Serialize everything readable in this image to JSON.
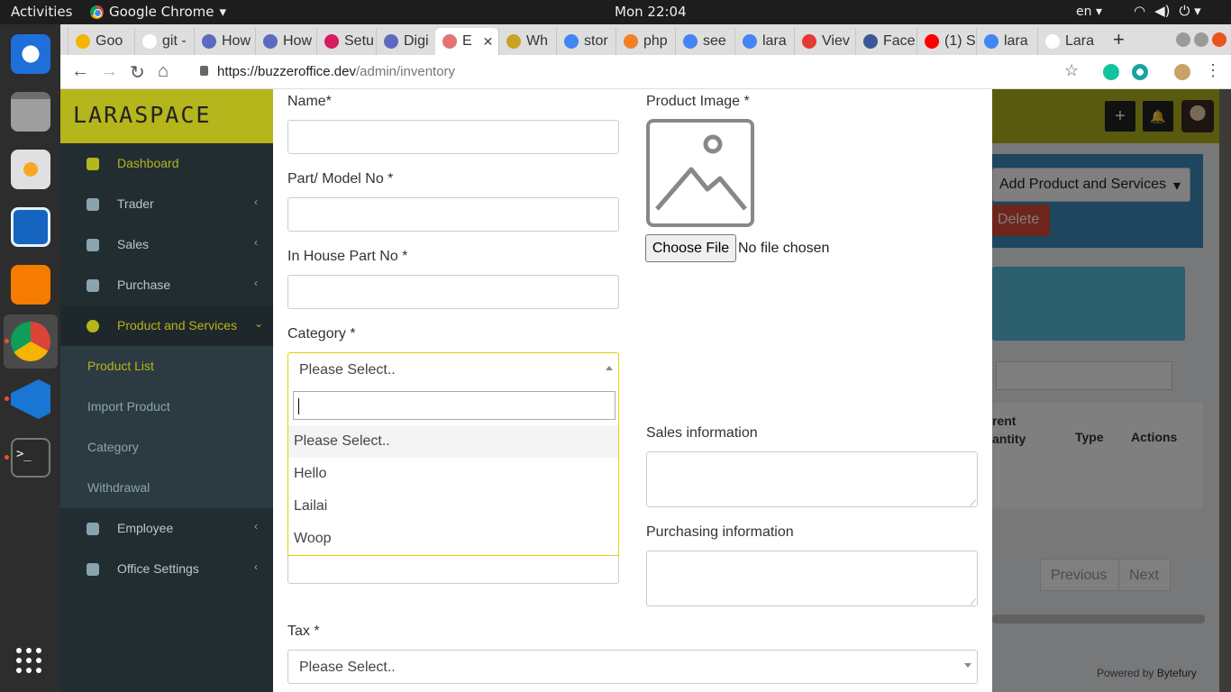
{
  "os": {
    "activities": "Activities",
    "app_name": "Google Chrome",
    "clock": "Mon 22:04",
    "lang": "en"
  },
  "browser": {
    "tabs": [
      {
        "label": "Goo",
        "color": "#f4b400"
      },
      {
        "label": "git -",
        "color": "#ffffff"
      },
      {
        "label": "How",
        "color": "#5c6bc0"
      },
      {
        "label": "How",
        "color": "#5c6bc0"
      },
      {
        "label": "Setu",
        "color": "#d81b60"
      },
      {
        "label": "Digi",
        "color": "#5c6bc0"
      },
      {
        "label": "E",
        "color": "#e57373"
      },
      {
        "label": "Wh",
        "color": "#c9a227"
      },
      {
        "label": "stor",
        "color": "#4285f4"
      },
      {
        "label": "php",
        "color": "#f48024"
      },
      {
        "label": "see",
        "color": "#4285f4"
      },
      {
        "label": "lara",
        "color": "#4285f4"
      },
      {
        "label": "Viev",
        "color": "#e53935"
      },
      {
        "label": "Face",
        "color": "#3b5998"
      },
      {
        "label": "(1) S",
        "color": "#ff0000"
      },
      {
        "label": "lara",
        "color": "#4285f4"
      },
      {
        "label": "Lara",
        "color": "#ffffff"
      }
    ],
    "url_host": "https://buzzeroffice.dev",
    "url_path": "/admin/inventory"
  },
  "app": {
    "brand": "LARASPACE",
    "menu": [
      {
        "label": "Dashboard",
        "has_chevron": false,
        "highlight": true
      },
      {
        "label": "Trader",
        "has_chevron": true
      },
      {
        "label": "Sales",
        "has_chevron": true
      },
      {
        "label": "Purchase",
        "has_chevron": true
      },
      {
        "label": "Product and Services",
        "has_chevron": true,
        "open": true
      },
      {
        "label": "Employee",
        "has_chevron": true
      },
      {
        "label": "Office Settings",
        "has_chevron": true
      }
    ],
    "submenu": [
      "Product List",
      "Import Product",
      "Category",
      "Withdrawal"
    ],
    "bg": {
      "add_button": "Add Product and Services",
      "delete_button": "Delete",
      "col_quantity": "rent\nantity",
      "col_type": "Type",
      "col_actions": "Actions",
      "previous": "Previous",
      "next": "Next",
      "footer_prefix": "Powered by",
      "footer_brand": "Bytefury"
    }
  },
  "form": {
    "name_label": "Name*",
    "model_label": "Part/ Model No *",
    "inhouse_label": "In House Part No *",
    "category_label": "Category *",
    "category_value": "Please Select..",
    "category_options": [
      "Please Select..",
      "Hello",
      "Lailai",
      "Woop"
    ],
    "image_label": "Product Image *",
    "choose_file": "Choose File",
    "no_file": "No file chosen",
    "sales_label": "Sales information",
    "purchasing_label": "Purchasing information",
    "tax_label": "Tax *",
    "tax_value": "Please Select.."
  }
}
